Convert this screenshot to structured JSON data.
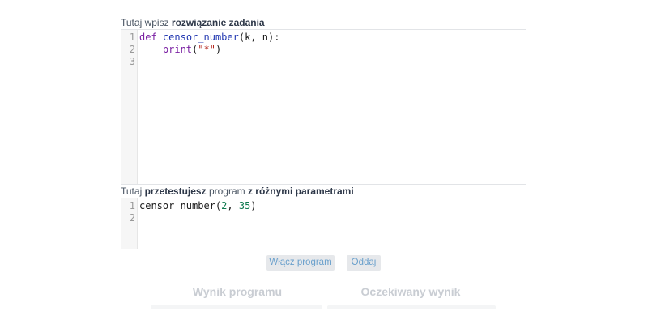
{
  "solution_label": {
    "prefix": "Tutaj wpisz ",
    "bold": "rozwiązanie zadania"
  },
  "solution_editor": {
    "line_numbers": [
      "1",
      "2",
      "3"
    ],
    "lines": [
      [
        {
          "t": "def",
          "c": "kw"
        },
        {
          "t": " ",
          "c": ""
        },
        {
          "t": "censor_number",
          "c": "fn"
        },
        {
          "t": "(k, n):",
          "c": ""
        }
      ],
      [
        {
          "t": "    ",
          "c": ""
        },
        {
          "t": "print",
          "c": "bi"
        },
        {
          "t": "(",
          "c": ""
        },
        {
          "t": "\"*\"",
          "c": "str"
        },
        {
          "t": ")",
          "c": ""
        }
      ],
      []
    ]
  },
  "test_label": {
    "part1": "Tutaj ",
    "bold1": "przetestujesz",
    "part2": " program ",
    "bold2": "z różnymi parametrami"
  },
  "test_editor": {
    "line_numbers": [
      "1",
      "2"
    ],
    "lines": [
      [
        {
          "t": "censor_number(",
          "c": ""
        },
        {
          "t": "2",
          "c": "num"
        },
        {
          "t": ", ",
          "c": ""
        },
        {
          "t": "35",
          "c": "num"
        },
        {
          "t": ")",
          "c": ""
        }
      ],
      []
    ]
  },
  "buttons": {
    "run_label": "Włącz program",
    "submit_label": "Oddaj"
  },
  "results": {
    "output_title": "Wynik programu",
    "expected_title": "Oczekiwany wynik"
  }
}
